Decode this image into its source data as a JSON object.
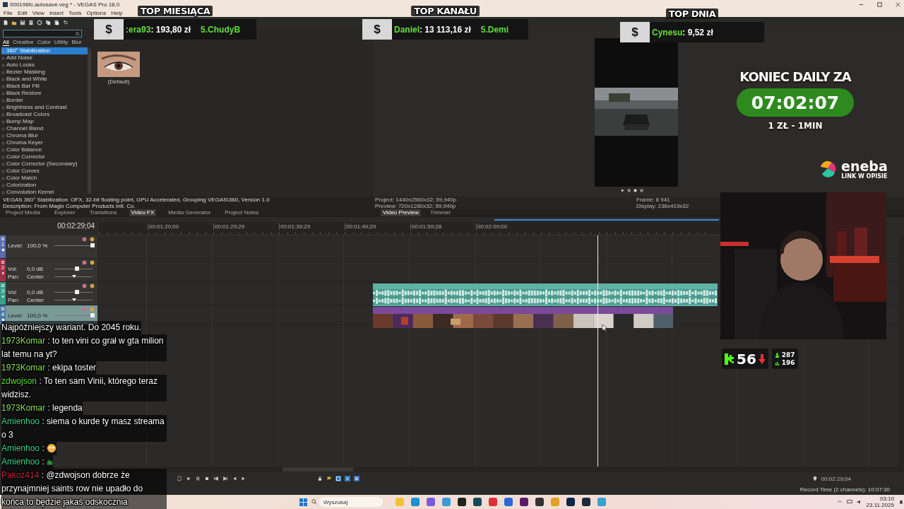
{
  "window": {
    "title": "000196fc.autosave.veg * - VEGAS Pro 18.0"
  },
  "menu": [
    "File",
    "Edit",
    "View",
    "Insert",
    "Tools",
    "Options",
    "Help"
  ],
  "fx_categories": [
    {
      "label": "All",
      "selected": true
    },
    {
      "label": "Creative",
      "selected": false
    },
    {
      "label": "Color",
      "selected": false
    },
    {
      "label": "Utility",
      "selected": false
    },
    {
      "label": "Blur",
      "selected": false
    }
  ],
  "fx_list": [
    {
      "label": "360° Stabilization",
      "selected": true
    },
    {
      "label": "Add Noise",
      "selected": false
    },
    {
      "label": "Auto Looks",
      "selected": false
    },
    {
      "label": "Bezier Masking",
      "selected": false
    },
    {
      "label": "Black and White",
      "selected": false
    },
    {
      "label": "Black Bar Fill",
      "selected": false
    },
    {
      "label": "Black Restore",
      "selected": false
    },
    {
      "label": "Border",
      "selected": false
    },
    {
      "label": "Brightness and Contrast",
      "selected": false
    },
    {
      "label": "Broadcast Colors",
      "selected": false
    },
    {
      "label": "Bump Map",
      "selected": false
    },
    {
      "label": "Channel Blend",
      "selected": false
    },
    {
      "label": "Chroma Blur",
      "selected": false
    },
    {
      "label": "Chroma Keyer",
      "selected": false
    },
    {
      "label": "Color Balance",
      "selected": false
    },
    {
      "label": "Color Corrector",
      "selected": false
    },
    {
      "label": "Color Corrector (Secondary)",
      "selected": false
    },
    {
      "label": "Color Curves",
      "selected": false
    },
    {
      "label": "Color Match",
      "selected": false
    },
    {
      "label": "Colorization",
      "selected": false
    },
    {
      "label": "Convolution Kernel",
      "selected": false
    }
  ],
  "preset": {
    "label": "(Default)"
  },
  "description": [
    "VEGAS 360° Stabilization: OFX, 32-bit floating point, GPU Accelerated, Grouping VEGAS\\360, Version 1.0",
    "Description: From Magix Computer Products Intl. Co."
  ],
  "dock_tabs": [
    {
      "label": "Project Media",
      "selected": false
    },
    {
      "label": "Explorer",
      "selected": false
    },
    {
      "label": "Transitions",
      "selected": false
    },
    {
      "label": "Video FX",
      "selected": true
    },
    {
      "label": "Media Generator",
      "selected": false
    },
    {
      "label": "Project Notes",
      "selected": false
    }
  ],
  "preview": {
    "info_left": [
      "Project: 1440x2560x32; 59,940p",
      "Preview: 720x1280x32; 59,940p"
    ],
    "info_right": [
      "Frame: 8 941",
      "Display: 236x419x32"
    ],
    "tabs": [
      {
        "label": "Video Preview",
        "selected": true
      },
      {
        "label": "Trimmer",
        "selected": false
      }
    ]
  },
  "timeline": {
    "time": "00:02:29;04",
    "ruler": [
      "00:01:20;00",
      "00:01:29;29",
      "00:01:39;29",
      "00:01:49;29",
      "00:01:59;28",
      "00:02:09;00"
    ],
    "tracks": [
      {
        "number": "1",
        "kind": "video",
        "color": "#5a6cae",
        "selected": false,
        "rows": [
          {
            "kind": "fader",
            "label": "Level:",
            "value": "100,0 %",
            "level": 1
          }
        ]
      },
      {
        "number": "2",
        "kind": "audio",
        "color": "#a13049",
        "selected": false,
        "rows": [
          {
            "kind": "fader",
            "label": "Vol:",
            "value": "0,0 dB",
            "level": 0.6
          },
          {
            "kind": "pan",
            "label": "Pan:",
            "value": "Center",
            "level": 0.52
          }
        ]
      },
      {
        "number": "3",
        "kind": "audio",
        "color": "#3a9e8c",
        "selected": false,
        "rows": [
          {
            "kind": "fader",
            "label": "Vol:",
            "value": "0,0 dB",
            "level": 0.6
          },
          {
            "kind": "pan",
            "label": "Pan:",
            "value": "Center",
            "level": 0.52
          }
        ]
      },
      {
        "number": "4",
        "kind": "video",
        "color": "#4d78a8",
        "selected": true,
        "rows": [
          {
            "kind": "fader",
            "label": "Level:",
            "value": "100,0 %",
            "level": 1
          }
        ]
      }
    ]
  },
  "status_bar": {
    "time": "00:02:29;04",
    "record_time": "Record Time (2 channels): 10:07:30"
  },
  "taskbar": {
    "search": {
      "placeholder": "Wyszukaj"
    },
    "time": "03:10",
    "date": "23.11.2025"
  },
  "leaderboards": [
    {
      "title": "TOP MIESIĄCA",
      "symbol": "$",
      "name": ":era93",
      "amount": ": 193,80 zł",
      "next": "5.ChudyB"
    },
    {
      "title": "TOP KANAŁU",
      "symbol": "$",
      "name": "Daniel",
      "amount": ": 13 113,16 zł",
      "next": "5.Demi"
    },
    {
      "title": "TOP DNIA",
      "symbol": "$",
      "name": "Cynesu",
      "amount": ": 9,52 zł"
    }
  ],
  "daily": {
    "title": "KONIEC DAILY ZA",
    "timer": "07:02:07",
    "rate": "1 ZŁ - 1MIN"
  },
  "sponsor": {
    "name": "eneba",
    "note": "LINK W OPISIE"
  },
  "stream_stats": {
    "rank": "56",
    "upper": "287",
    "lower": "196"
  },
  "chat": [
    {
      "kind": "text",
      "text": "Najpóźniejszy wariant. Do 2045 roku."
    },
    {
      "kind": "text",
      "user": "1973Komar",
      "color": "#8fe05c",
      "separator": ":",
      "text": "to ten vini co grał w gta milion lat temu na yt?"
    },
    {
      "kind": "text",
      "user": "1973Komar",
      "color": "#8fe05c",
      "separator": ":",
      "text": "ekipa toster"
    },
    {
      "kind": "text",
      "user": "zdwojson",
      "color": "#5be03c",
      "separator": ":",
      "text": "To ten sam Vinii, którego teraz widzisz."
    },
    {
      "kind": "text",
      "user": "1973Komar",
      "color": "#8fe05c",
      "separator": ":",
      "text": "legenda"
    },
    {
      "kind": "text",
      "user": "Amienhoo",
      "color": "#3dd68c",
      "separator": ":",
      "text": "siema o kurde ty masz streama o 3"
    },
    {
      "kind": "emoji",
      "user": "Amienhoo",
      "color": "#3dd68c",
      "separator": ":"
    },
    {
      "kind": "emote",
      "user": "Amienhoo",
      "color": "#3dd68c",
      "separator": ":"
    },
    {
      "kind": "text",
      "user": "Pakoz414",
      "color": "#c8243c",
      "separator": ":",
      "text": "@zdwojson dobrze że przynajmniej saints row nie upadło do końca to będzie jakaś odskocznia"
    }
  ]
}
